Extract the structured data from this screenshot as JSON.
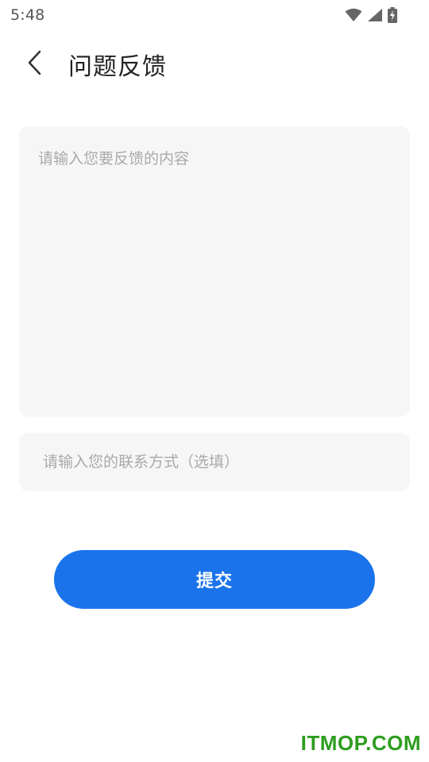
{
  "status_bar": {
    "time": "5:48",
    "icons": [
      "wifi-icon",
      "signal-icon",
      "battery-charging-icon"
    ]
  },
  "header": {
    "back_icon": "chevron-left-icon",
    "title": "问题反馈"
  },
  "form": {
    "feedback_placeholder": "请输入您要反馈的内容",
    "feedback_value": "",
    "contact_placeholder": "请输入您的联系方式（选填）",
    "contact_value": "",
    "submit_label": "提交"
  },
  "watermark": "ITMOP.COM",
  "colors": {
    "accent": "#1a73eb",
    "input_bg": "#f6f6f6",
    "placeholder": "#a9a9a9",
    "watermark": "#2d9d1f"
  }
}
